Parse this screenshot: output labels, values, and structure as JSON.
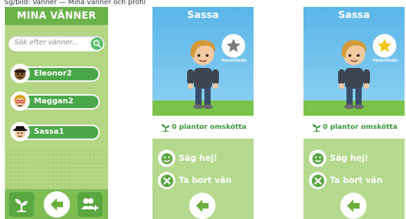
{
  "caption": "Sg/bild: Vänner — Mina vänner och profil",
  "friends_panel": {
    "title": "MINA VÄNNER",
    "search_placeholder": "Sök efter vänner...",
    "friends": [
      {
        "name": "Eleonor2"
      },
      {
        "name": "Maggan2"
      },
      {
        "name": "Sassa1"
      }
    ],
    "icons": {
      "plant": "plant-icon",
      "back": "back-arrow-icon",
      "add_friend": "add-friend-icon",
      "search": "search-icon"
    }
  },
  "profile_cards": [
    {
      "name": "Sassa",
      "favorite_label": "Favoritvän",
      "favorite": false,
      "plants_text": "0 plantor omskötta",
      "actions": [
        {
          "label": "Säg hej!",
          "icon": "smiley-icon"
        },
        {
          "label": "Ta bort vän",
          "icon": "close-icon"
        }
      ]
    },
    {
      "name": "Sassa",
      "favorite_label": "Favoritvän",
      "favorite": true,
      "plants_text": "0 plantor omskötta",
      "actions": [
        {
          "label": "Säg hej!",
          "icon": "smiley-icon"
        },
        {
          "label": "Ta bort vän",
          "icon": "close-icon"
        }
      ]
    }
  ],
  "colors": {
    "panel_green": "#b4d685",
    "header_green": "#6bb24a",
    "pill_green": "#4aa84a",
    "star_inactive": "#7a7a7a",
    "star_active": "#f5c518"
  }
}
